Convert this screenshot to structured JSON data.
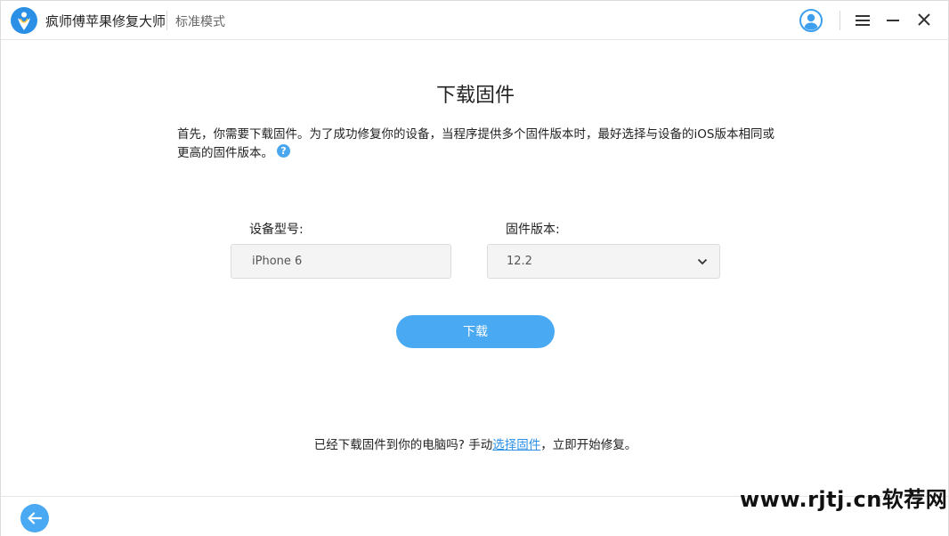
{
  "titlebar": {
    "app_name": "疯师傅苹果修复大师",
    "mode": "标准模式",
    "icons": {
      "logo": "app-logo-icon",
      "avatar": "user-avatar-icon",
      "menu": "menu-icon",
      "minimize": "minimize-icon",
      "close": "close-icon"
    }
  },
  "main": {
    "title": "下载固件",
    "intro": "首先，你需要下载固件。为了成功修复你的设备，当程序提供多个固件版本时，最好选择与设备的iOS版本相同或更高的固件版本。",
    "help_symbol": "?",
    "device_model": {
      "label": "设备型号:",
      "value": "iPhone 6"
    },
    "firmware_version": {
      "label": "固件版本:",
      "value": "12.2"
    },
    "download_button": "下载",
    "footer_prefix": "已经下载固件到你的电脑吗? 手动",
    "footer_link": "选择固件",
    "footer_suffix": "，立即开始修复。"
  },
  "watermark": "www.rjtj.cn软荐网",
  "colors": {
    "accent": "#4aa9f3",
    "link": "#2b8fe6"
  }
}
